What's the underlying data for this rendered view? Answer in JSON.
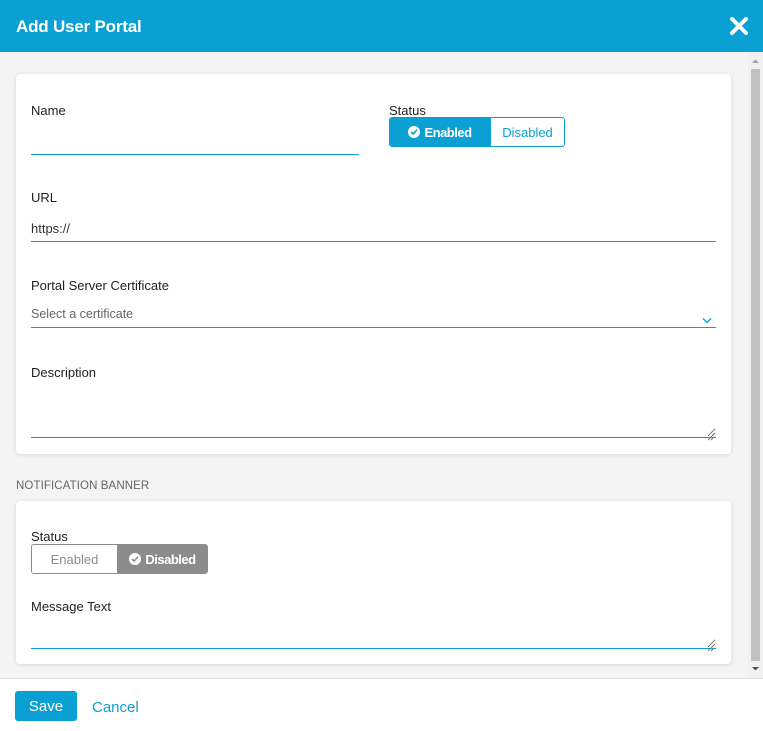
{
  "dialog": {
    "title": "Add User Portal",
    "close_icon": "close-icon"
  },
  "colors": {
    "accent": "#0aa0d4",
    "inactive_toggle": "#8c8c8c",
    "body_bg": "#f4f4f4"
  },
  "form": {
    "name": {
      "label": "Name",
      "value": ""
    },
    "status": {
      "label": "Status",
      "options": [
        "Enabled",
        "Disabled"
      ],
      "selected": "Enabled"
    },
    "url": {
      "label": "URL",
      "value": "https://"
    },
    "certificate": {
      "label": "Portal Server Certificate",
      "placeholder": "Select a certificate",
      "chevron_icon": "chevron-down-icon"
    },
    "description": {
      "label": "Description",
      "value": ""
    }
  },
  "notification_banner": {
    "section_title": "NOTIFICATION BANNER",
    "status": {
      "label": "Status",
      "options": [
        "Enabled",
        "Disabled"
      ],
      "selected": "Disabled"
    },
    "message_text": {
      "label": "Message Text",
      "value": ""
    }
  },
  "footer": {
    "save_label": "Save",
    "cancel_label": "Cancel"
  }
}
